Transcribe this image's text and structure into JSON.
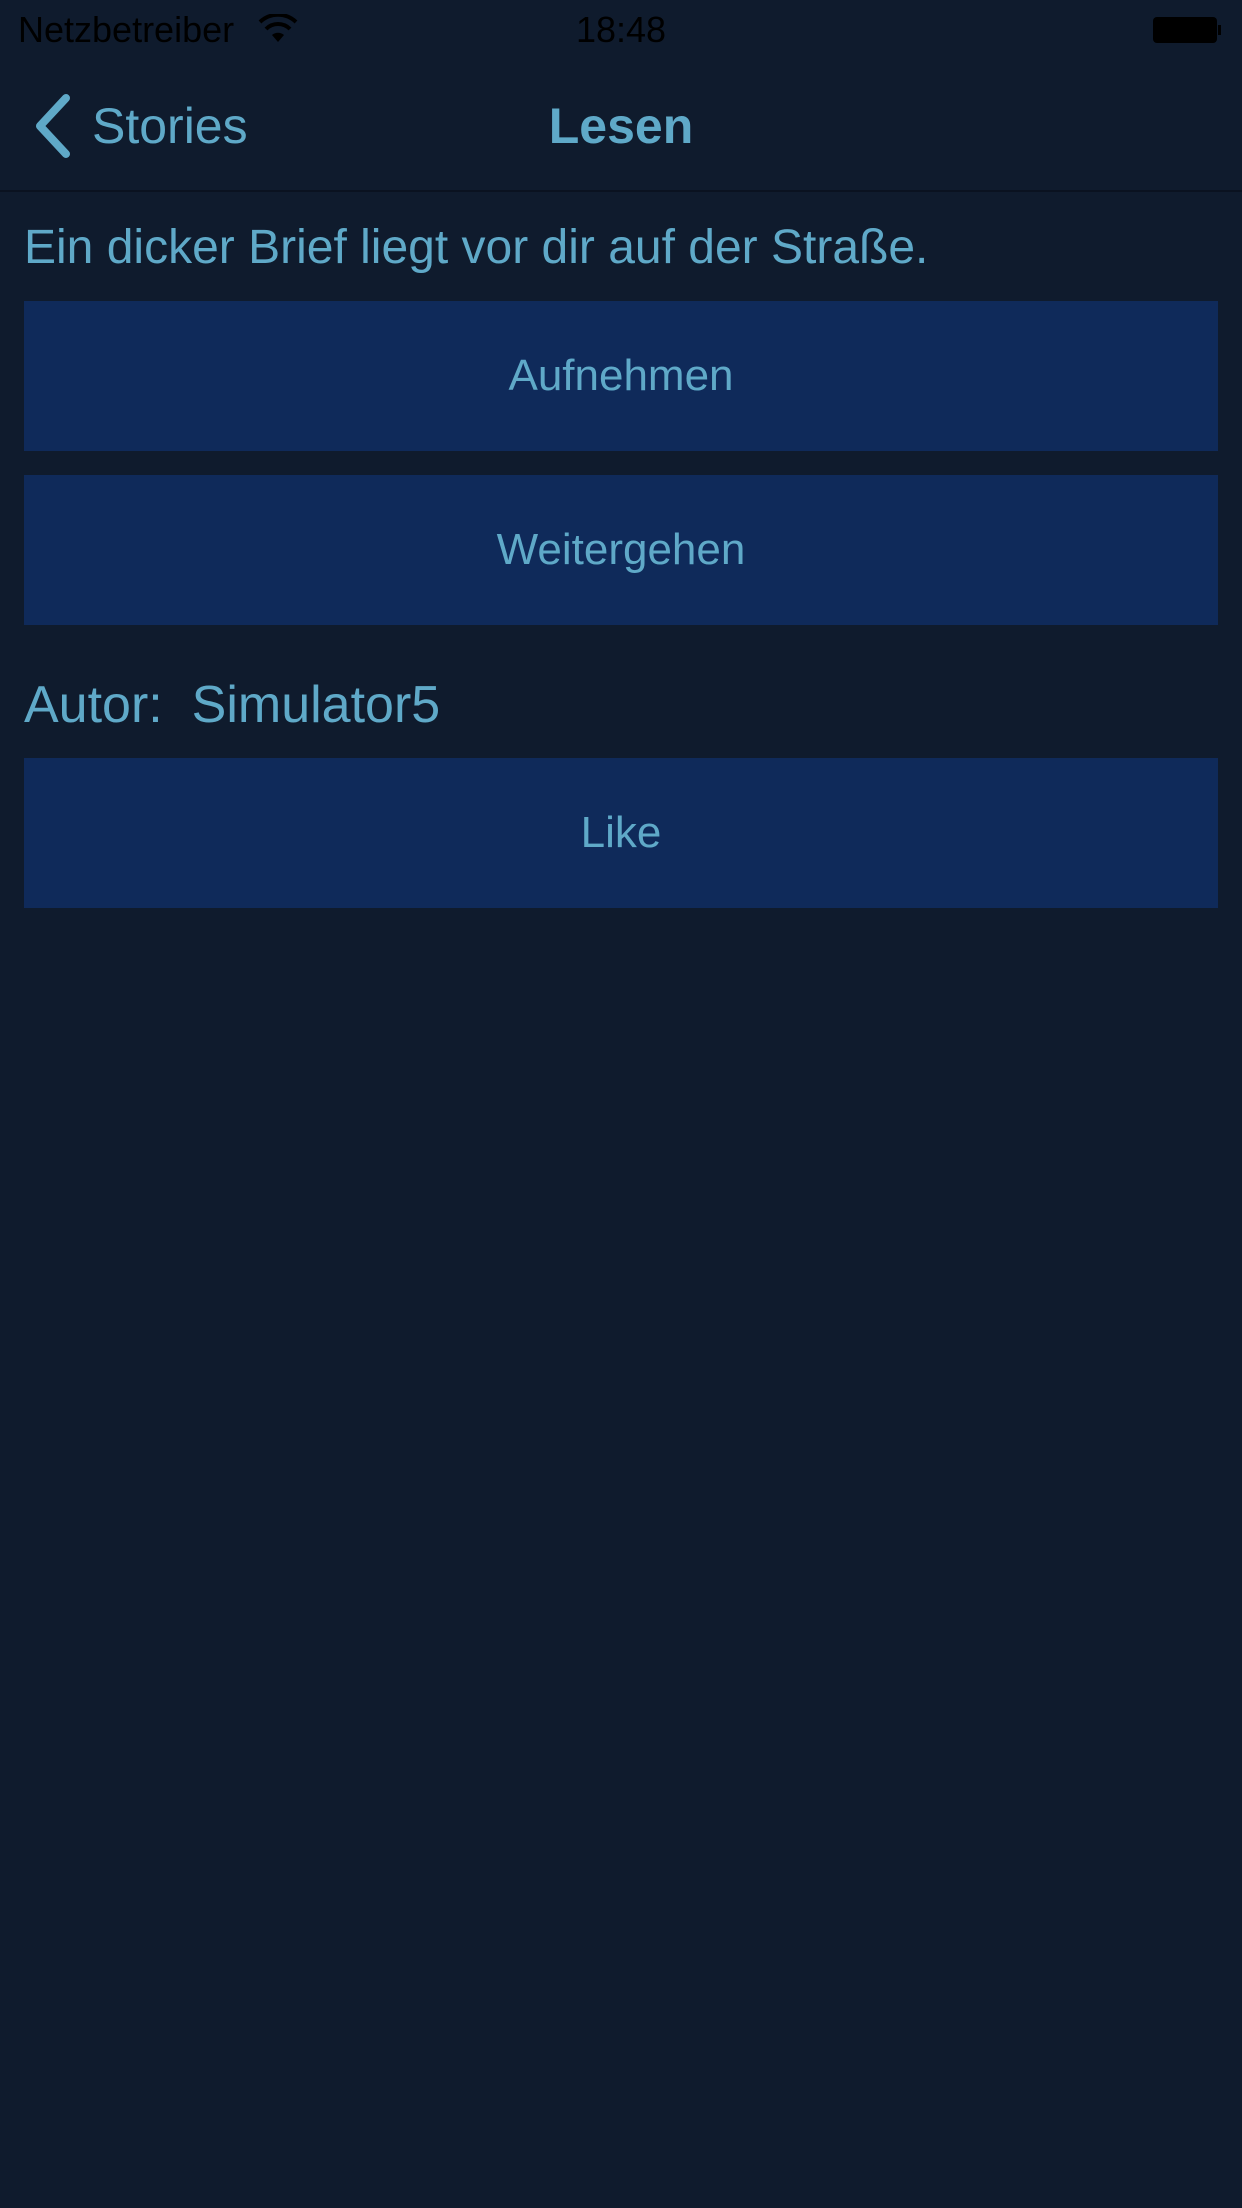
{
  "status_bar": {
    "carrier": "Netzbetreiber",
    "time": "18:48",
    "wifi_icon": "wifi-icon",
    "battery_icon": "battery-icon"
  },
  "nav": {
    "back_label": "Stories",
    "back_icon": "chevron-left-icon",
    "title": "Lesen"
  },
  "story": {
    "text": "Ein dicker Brief liegt vor dir auf der Straße.",
    "choices": [
      {
        "label": "Aufnehmen"
      },
      {
        "label": "Weitergehen"
      }
    ]
  },
  "author": {
    "label": "Autor:",
    "name": "Simulator5"
  },
  "like": {
    "label": "Like"
  },
  "colors": {
    "background": "#0f1b2d",
    "button_background": "#0f2a5a",
    "accent_text": "#5fa9c8"
  }
}
